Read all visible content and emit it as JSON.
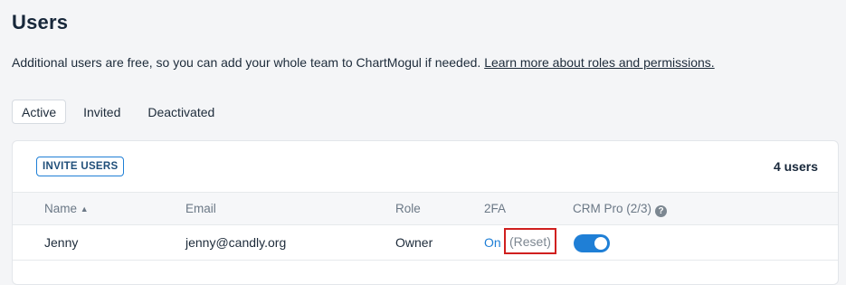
{
  "page": {
    "title": "Users",
    "intro_text": "Additional users are free, so you can add your whole team to ChartMogul if needed. ",
    "intro_link": "Learn more about roles and permissions."
  },
  "tabs": [
    {
      "label": "Active",
      "active": true
    },
    {
      "label": "Invited",
      "active": false
    },
    {
      "label": "Deactivated",
      "active": false
    }
  ],
  "toolbar": {
    "invite_label": "INVITE USERS",
    "user_count": "4 users"
  },
  "table": {
    "columns": {
      "name": "Name",
      "sort_indicator": "▲",
      "email": "Email",
      "role": "Role",
      "twofa": "2FA",
      "crm": "CRM Pro (2/3)",
      "help": "?"
    },
    "rows": [
      {
        "name": "Jenny",
        "email": "jenny@candly.org",
        "role": "Owner",
        "twofa": "On",
        "reset": "(Reset)",
        "crm_enabled": true
      }
    ]
  },
  "colors": {
    "accent": "#1f7fd6",
    "highlight": "#d0201f"
  }
}
